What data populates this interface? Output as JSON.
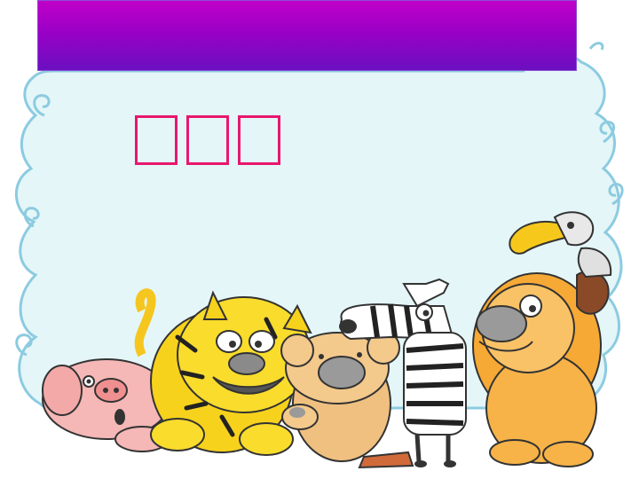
{
  "slide": {
    "title_bar_text": "",
    "heading": "□□□",
    "heading_glyphs": [
      "□",
      "□",
      "□"
    ]
  },
  "colors": {
    "title_bar_top": "#c000c8",
    "title_bar_bottom": "#6a10c0",
    "cloud_fill": "#e4f6f8",
    "cloud_outline": "#8ccbe0",
    "heading_color": "#e8176e"
  },
  "illustration": {
    "animals": [
      "pig",
      "tiger",
      "bear",
      "zebra",
      "lion",
      "eagle"
    ]
  }
}
